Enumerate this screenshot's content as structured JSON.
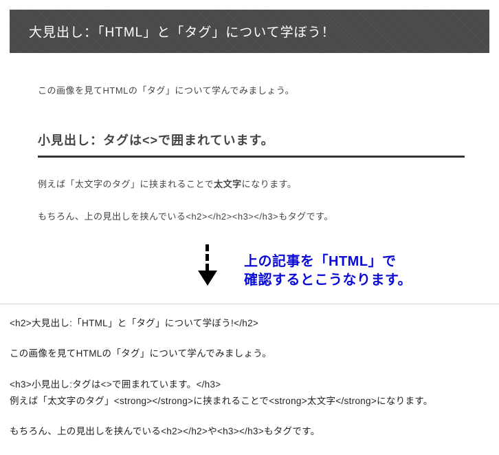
{
  "header": {
    "title": "大見出し：「HTML」と「タグ」について学ぼう！"
  },
  "article": {
    "intro": "この画像を見てHTMLの「タグ」について学んでみましょう。",
    "subhead": "小見出し：タグは<>で囲まれています。",
    "p1_prefix": "例えば「太文字のタグ」に挟まれることで",
    "p1_bold": "太文字",
    "p1_suffix": "になります。",
    "p2": "もちろん、上の見出しを挟んでいる<h2></h2><h3></h3>もタグです。"
  },
  "annotation": {
    "blue_text": "上の記事を「HTML」で\n確認するとこうなります。"
  },
  "source": {
    "line1": "<h2>大見出し:「HTML」と「タグ」について学ぼう!</h2>",
    "line2": "この画像を見てHTMLの「タグ」について学んでみましょう。",
    "line3": "<h3>小見出し:タグは<>で囲まれています。</h3>",
    "line4": "例えば「太文字のタグ」<strong></strong>に挟まれることで<strong>太文字</strong>になります。",
    "line5": "もちろん、上の見出しを挟んでいる<h2></h2>や<h3></h3>もタグです。"
  }
}
